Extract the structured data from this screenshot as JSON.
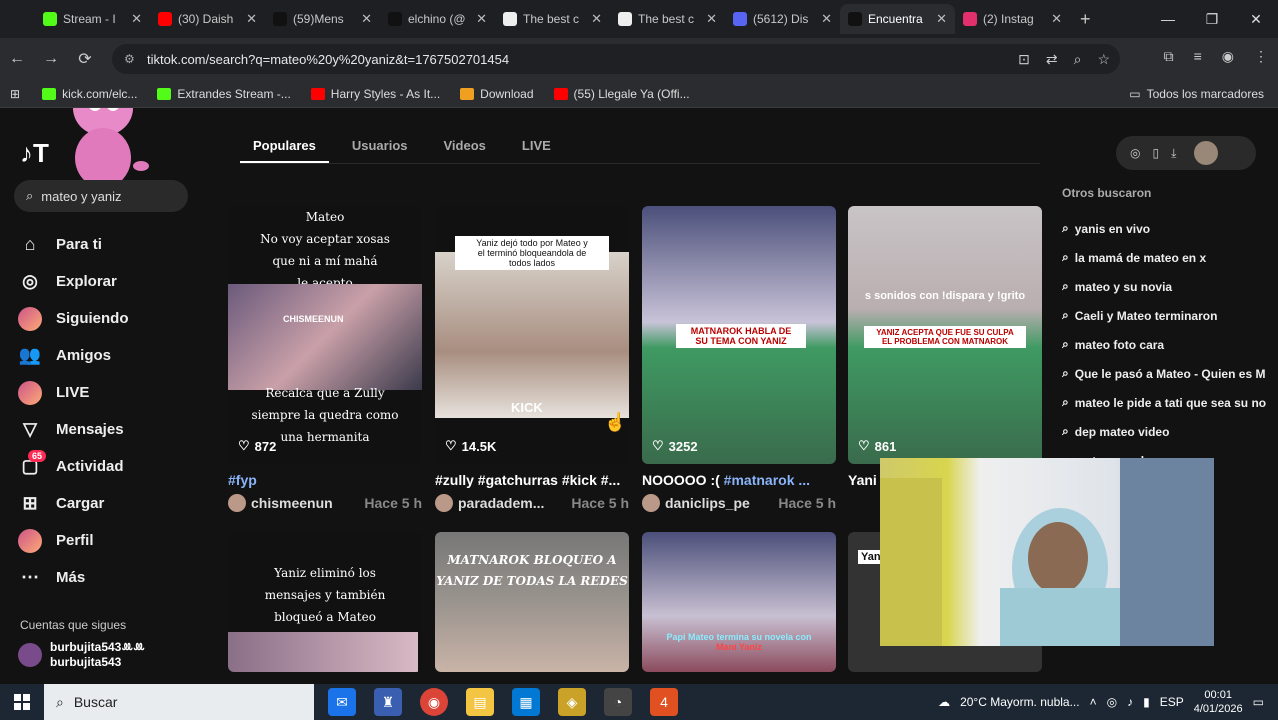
{
  "browser": {
    "tabs": [
      {
        "title": "Stream - I",
        "color": "#53fc18"
      },
      {
        "title": "(30) Daish",
        "color": "#ff0000"
      },
      {
        "title": "(59)Mens",
        "color": "#111111"
      },
      {
        "title": "elchino (@",
        "color": "#111111"
      },
      {
        "title": "The best c",
        "color": "#eeeeee"
      },
      {
        "title": "The best c",
        "color": "#eeeeee"
      },
      {
        "title": "(5612) Dis",
        "color": "#5865f2"
      },
      {
        "title": "Encuentra",
        "color": "#111111"
      },
      {
        "title": "(2) Instag",
        "color": "#e1306c"
      }
    ],
    "new_tab": "+",
    "window_controls": [
      "—",
      "❐",
      "✕"
    ],
    "url": "tiktok.com/search?q=mateo%20y%20yaniz&t=1767502701454",
    "bookmarks": [
      {
        "label": "kick.com/elc...",
        "color": "#53fc18"
      },
      {
        "label": "Extrandes Stream -...",
        "color": "#53fc18"
      },
      {
        "label": "Harry Styles - As It...",
        "color": "#ff0000"
      },
      {
        "label": "Download",
        "color": "#f0a020"
      },
      {
        "label": "(55) Llegale Ya (Offi...",
        "color": "#ff0000"
      }
    ],
    "all_bookmarks": "Todos los marcadores"
  },
  "tiktok": {
    "logo": "T",
    "search_value": "mateo y yaniz",
    "nav": [
      {
        "label": "Para ti",
        "icon": "⌂"
      },
      {
        "label": "Explorar",
        "icon": "◎"
      },
      {
        "label": "Siguiendo",
        "icon": "avatar"
      },
      {
        "label": "Amigos",
        "icon": "👥"
      },
      {
        "label": "LIVE",
        "icon": "avatar"
      },
      {
        "label": "Mensajes",
        "icon": "▽"
      },
      {
        "label": "Actividad",
        "icon": "▢",
        "badge": "65"
      },
      {
        "label": "Cargar",
        "icon": "⊞"
      },
      {
        "label": "Perfil",
        "icon": "avatar"
      },
      {
        "label": "Más",
        "icon": "⋯"
      }
    ],
    "following_title": "Cuentas que sigues",
    "following": [
      {
        "display": "burbujita543ꔛꔛ",
        "handle": "burbujita543"
      }
    ],
    "content_tabs": [
      "Populares",
      "Usuarios",
      "Videos",
      "LIVE"
    ],
    "cards": [
      {
        "likes": "872",
        "caption_tag": "#fyp",
        "caption": "",
        "author": "chismeenun",
        "time": "Hace 5 h",
        "overlay_top": [
          "Mateo",
          "No voy aceptar xosas",
          "que ni a mí mahá",
          "le acepto"
        ],
        "overlay_bottom": [
          "Recalca que a Zully",
          "siempre la quedra como",
          "una hermanita"
        ],
        "mid": "CHISMEENUN"
      },
      {
        "likes": "14.5K",
        "caption_tag": "",
        "caption": "#zully #gatchurras #kick #...",
        "author": "paradadem...",
        "time": "Hace 5 h",
        "overlay_top": [
          "Yaniz dejó todo por Mateo y",
          "el terminó bloqueandola de",
          "todos lados"
        ],
        "mid": "KICK"
      },
      {
        "likes": "3252",
        "caption_tag": "#matnarok ...",
        "caption": "NOOOOO :( ",
        "author": "daniclips_pe",
        "time": "Hace 5 h",
        "overlay_top": [
          "MATNAROK HABLA DE",
          "SU TEMA CON YANIZ"
        ]
      },
      {
        "likes": "861",
        "caption_tag": "",
        "caption": "Yani",
        "author": "",
        "time": "",
        "overlay_top": [
          "s sonidos con !dispara y !grito"
        ],
        "overlay_mid": [
          "YANIZ ACEPTA QUE FUE SU CULPA",
          "EL PROBLEMA CON MATNAROK"
        ]
      },
      {
        "overlay_top": [
          "Yaniz eliminó los",
          "mensajes y también",
          "bloqueó a Mateo"
        ]
      },
      {
        "overlay_top": [
          "MATNAROK BLOQUEO A",
          "YANIZ DE TODAS LA REDES"
        ]
      },
      {
        "overlay_top": [
          "Papi Mateo termina su novela con",
          "Maní Yaniz"
        ]
      },
      {
        "overlay_top": [
          "Yan"
        ]
      }
    ],
    "other_searches_title": "Otros buscaron",
    "other_searches": [
      "yanis en vivo",
      "la mamá de mateo en x",
      "mateo y su novia",
      "Caeli y Mateo terminaron",
      "mateo foto cara",
      "Que le pasó a Mateo - Quien es M",
      "mateo le pide a tati que sea su no",
      "dep mateo video",
      "mateo y su hermana"
    ]
  },
  "taskbar": {
    "search_placeholder": "Buscar",
    "weather": "20°C  Mayorm. nubla...",
    "lang": "ESP",
    "time": "00:01",
    "date": "4/01/2026"
  }
}
